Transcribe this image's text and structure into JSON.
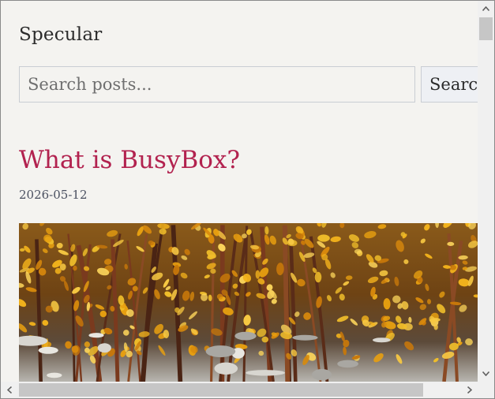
{
  "site": {
    "title": "Specular"
  },
  "search": {
    "placeholder": "Search posts...",
    "button_label": "Search"
  },
  "post": {
    "title": "What is BusyBox?",
    "date": "2026-05-12",
    "image": "autumn-shrubs-photo"
  },
  "scrollbars": {
    "vertical_position": 0.0,
    "horizontal_position": 0.0
  },
  "colors": {
    "background": "#f4f3f0",
    "post_title": "#b2224f",
    "date": "#4a5060",
    "button_bg": "#eef0f4"
  }
}
